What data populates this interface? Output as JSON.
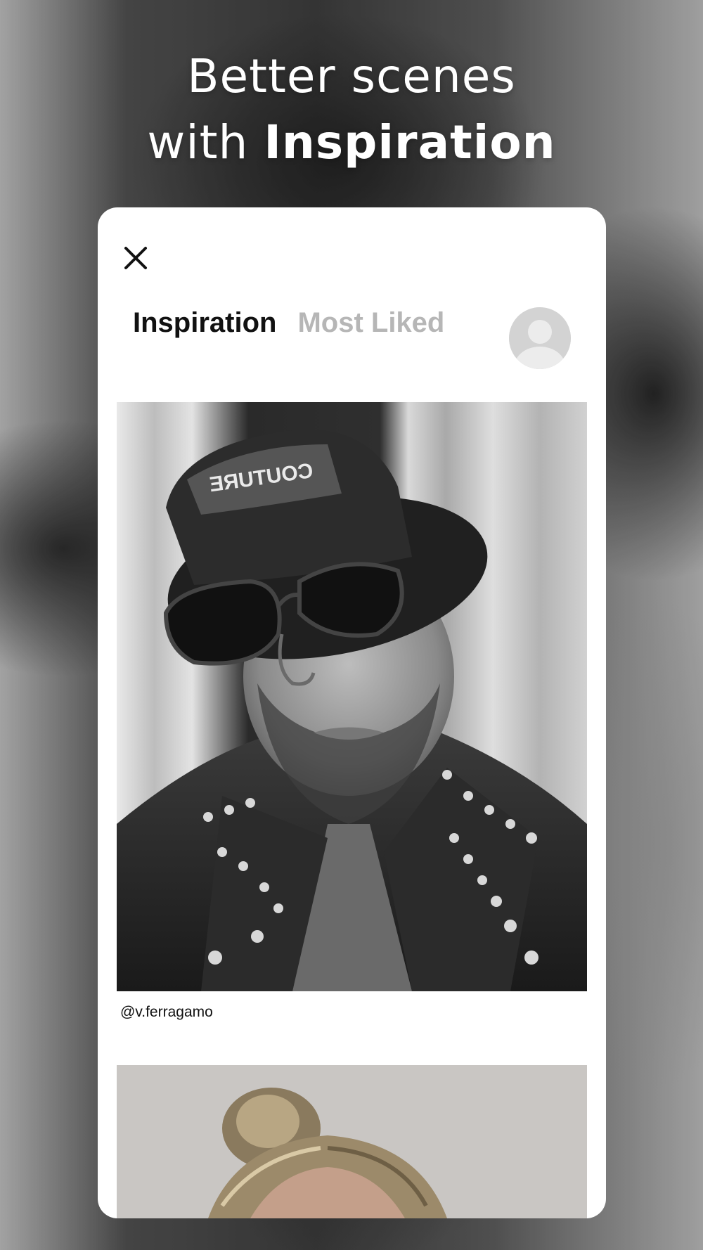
{
  "headline": {
    "line1": "Better scenes",
    "line2_prefix": "with ",
    "line2_bold": "Inspiration"
  },
  "modal": {
    "close_icon": "close-icon",
    "tabs": [
      {
        "label": "Inspiration",
        "active": true
      },
      {
        "label": "Most Liked",
        "active": false
      }
    ],
    "avatar_icon": "user-avatar-icon"
  },
  "feed": {
    "posts": [
      {
        "caption": "@v.ferragamo",
        "image": "portrait of man in bucket hat, sunglasses and studded leather jacket"
      },
      {
        "caption": "",
        "image": "portrait of woman with hair in a bun"
      }
    ]
  },
  "colors": {
    "tab_active": "#111111",
    "tab_inactive": "#b6b6b6",
    "card_background": "#ffffff"
  }
}
